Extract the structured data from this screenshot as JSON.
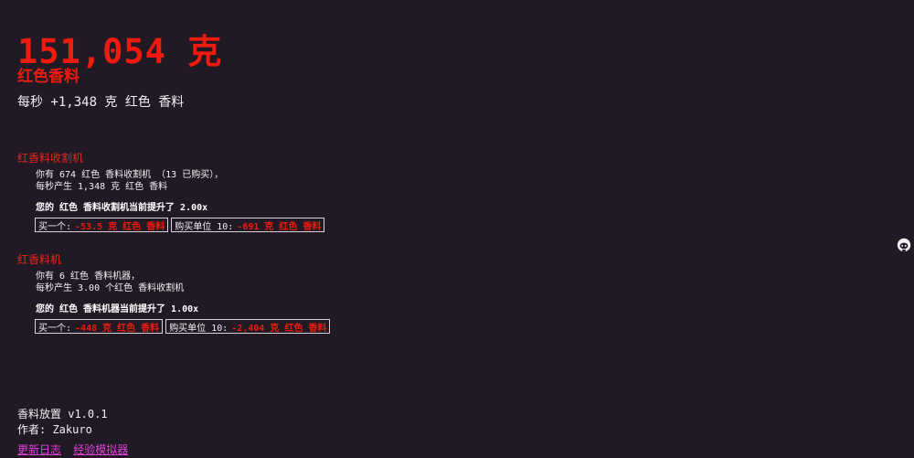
{
  "header": {
    "amount": "151,054 克",
    "resource_name": "红色香料",
    "rate": "每秒 +1,348 克 红色 香料"
  },
  "producers": [
    {
      "title": "红香料收割机",
      "line1": "你有 674 红色 香料收割机 （13 已购买），",
      "line2": "每秒产生 1,348 克 红色 香料",
      "boost": "您的 红色 香料收割机当前提升了 2.00x",
      "buy_one_label": "买一个:",
      "buy_one_cost": "-53.5 克 红色 香料",
      "buy_ten_label": "购买单位 10:",
      "buy_ten_cost": "-691 克 红色 香料"
    },
    {
      "title": "红香料机",
      "line1": "你有 6 红色 香料机器，",
      "line2": "每秒产生 3.00 个红色 香料收割机",
      "boost": "您的 红色 香料机器当前提升了 1.00x",
      "buy_one_label": "买一个:",
      "buy_one_cost": "-448 克 红色 香料",
      "buy_ten_label": "购买单位 10:",
      "buy_ten_cost": "-2,404 克 红色 香料"
    }
  ],
  "footer": {
    "version": "香料放置 v1.0.1",
    "author": "作者: Zakuro",
    "changelog_link": "更新日志",
    "simulator_link": "经验模拟器"
  },
  "icons": {
    "corner": "github-octocat-icon"
  },
  "colors": {
    "background": "#211a24",
    "accent_red": "#f01a0e",
    "link": "#e040d8"
  }
}
